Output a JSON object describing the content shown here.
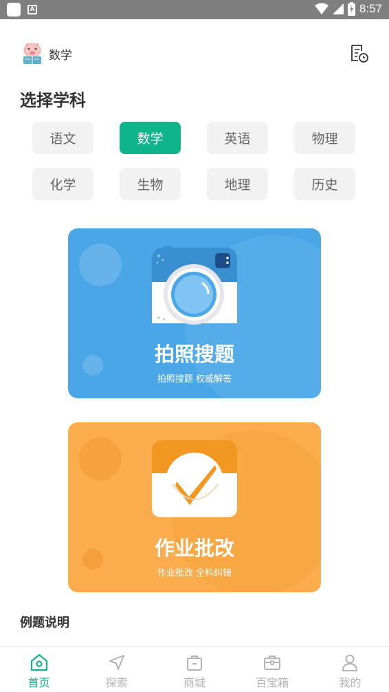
{
  "status_bar": {
    "time": "8:57"
  },
  "header": {
    "subject": "数学",
    "avatar_icon": "pig-avatar-icon",
    "history_icon": "history-icon"
  },
  "section_title": "选择学科",
  "subjects": [
    {
      "label": "语文",
      "active": false
    },
    {
      "label": "数学",
      "active": true
    },
    {
      "label": "英语",
      "active": false
    },
    {
      "label": "物理",
      "active": false
    },
    {
      "label": "化学",
      "active": false
    },
    {
      "label": "生物",
      "active": false
    },
    {
      "label": "地理",
      "active": false
    },
    {
      "label": "历史",
      "active": false
    }
  ],
  "cards": {
    "photo_search": {
      "title": "拍照搜题",
      "subtitle": "拍照搜题 权威解答",
      "icon": "camera-icon",
      "color": "#4aa6e7"
    },
    "homework_check": {
      "title": "作业批改",
      "subtitle": "作业批改 全科纠错",
      "icon": "checkmark-icon",
      "color": "#fbac4d"
    }
  },
  "examples_title": "例题说明",
  "bottom_nav": [
    {
      "label": "首页",
      "icon": "home-icon",
      "active": true
    },
    {
      "label": "探索",
      "icon": "explore-icon",
      "active": false
    },
    {
      "label": "商城",
      "icon": "shop-icon",
      "active": false
    },
    {
      "label": "百宝箱",
      "icon": "toolbox-icon",
      "active": false
    },
    {
      "label": "我的",
      "icon": "profile-icon",
      "active": false
    }
  ],
  "colors": {
    "accent": "#10b48a",
    "status_bar": "#7f7f7f"
  }
}
